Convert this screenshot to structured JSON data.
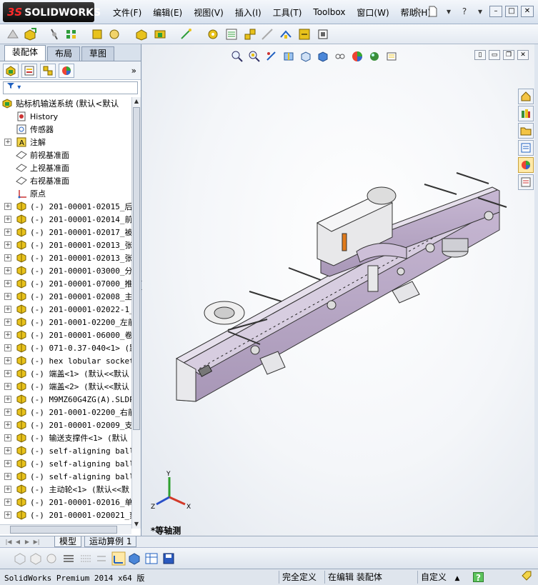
{
  "app": {
    "brand": "SOLIDWORKS",
    "brand_prefix": "3S",
    "menu": [
      "文件(F)",
      "编辑(E)",
      "视图(V)",
      "插入(I)",
      "工具(T)",
      "Toolbox",
      "窗口(W)",
      "帮助(H)"
    ]
  },
  "left_panel": {
    "tabs": [
      "装配体",
      "布局",
      "草图"
    ],
    "active_tab": "装配体",
    "more": "»",
    "tree": [
      {
        "kind": "root",
        "expand": "",
        "icon": "assembly-icon",
        "text": "贴标机输送系统  (默认<默认"
      },
      {
        "kind": "feature",
        "expand": "",
        "icon": "history-icon",
        "text": "History"
      },
      {
        "kind": "feature",
        "expand": "",
        "icon": "sensor-icon",
        "text": "传感器"
      },
      {
        "kind": "feature",
        "expand": "+",
        "icon": "annotation-icon",
        "text": "注解"
      },
      {
        "kind": "feature",
        "expand": "",
        "icon": "plane-icon",
        "text": "前视基准面"
      },
      {
        "kind": "feature",
        "expand": "",
        "icon": "plane-icon",
        "text": "上视基准面"
      },
      {
        "kind": "feature",
        "expand": "",
        "icon": "plane-icon",
        "text": "右视基准面"
      },
      {
        "kind": "feature",
        "expand": "",
        "icon": "origin-icon",
        "text": "原点"
      },
      {
        "kind": "part",
        "expand": "+",
        "icon": "subassembly-icon",
        "text": "(-) 201-00001-02015_后倾"
      },
      {
        "kind": "part",
        "expand": "+",
        "icon": "subassembly-icon",
        "text": "(-) 201-00001-02014_前倾"
      },
      {
        "kind": "part",
        "expand": "+",
        "icon": "subassembly-icon",
        "text": "(-) 201-00001-02017_被动"
      },
      {
        "kind": "part",
        "expand": "+",
        "icon": "subassembly-icon",
        "text": "(-) 201-00001-02013_张紧"
      },
      {
        "kind": "part",
        "expand": "+",
        "icon": "subassembly-icon",
        "text": "(-) 201-00001-02013_张紧"
      },
      {
        "kind": "part",
        "expand": "+",
        "icon": "subassembly-icon",
        "text": "(-) 201-00001-03000_分瓶"
      },
      {
        "kind": "part",
        "expand": "+",
        "icon": "subassembly-icon",
        "text": "(-) 201-00001-07000_推瓶"
      },
      {
        "kind": "part",
        "expand": "+",
        "icon": "subassembly-icon",
        "text": "(-) 201-00001-02008_主动"
      },
      {
        "kind": "part",
        "expand": "+",
        "icon": "subassembly-icon",
        "text": "(-) 201-00001-02022-1_调"
      },
      {
        "kind": "part",
        "expand": "+",
        "icon": "subassembly-icon",
        "text": "(-) 201-0001-02200_左前"
      },
      {
        "kind": "part",
        "expand": "+",
        "icon": "subassembly-icon",
        "text": "(-) 201-00001-06000_卷瓶"
      },
      {
        "kind": "part",
        "expand": "+",
        "icon": "subassembly-icon",
        "text": "(-) 071-0.37-040<1> (默"
      },
      {
        "kind": "part",
        "expand": "+",
        "icon": "subassembly-icon",
        "text": "(-) hex lobular socket"
      },
      {
        "kind": "part",
        "expand": "+",
        "icon": "subassembly-icon",
        "text": "(-) 端盖<1> (默认<<默认"
      },
      {
        "kind": "part",
        "expand": "+",
        "icon": "subassembly-icon",
        "text": "(-) 端盖<2> (默认<<默认"
      },
      {
        "kind": "part",
        "expand": "+",
        "icon": "subassembly-icon",
        "text": "(-) M9MZ60G4ZG(A).SLDPR"
      },
      {
        "kind": "part",
        "expand": "+",
        "icon": "subassembly-icon",
        "text": "(-) 201-0001-02200_右前"
      },
      {
        "kind": "part",
        "expand": "+",
        "icon": "subassembly-icon",
        "text": "(-) 201-00001-02009_支撑"
      },
      {
        "kind": "part",
        "expand": "+",
        "icon": "subassembly-icon",
        "text": "(-) 输送支撑件<1> (默认"
      },
      {
        "kind": "part",
        "expand": "+",
        "icon": "subassembly-icon",
        "text": "(-) self-aligning ball"
      },
      {
        "kind": "part",
        "expand": "+",
        "icon": "subassembly-icon",
        "text": "(-) self-aligning ball"
      },
      {
        "kind": "part",
        "expand": "+",
        "icon": "subassembly-icon",
        "text": "(-) self-aligning ball"
      },
      {
        "kind": "part",
        "expand": "+",
        "icon": "subassembly-icon",
        "text": "(-) 主动轮<1> (默认<<默"
      },
      {
        "kind": "part",
        "expand": "+",
        "icon": "subassembly-icon",
        "text": "(-) 201-00001-02016_单链"
      },
      {
        "kind": "part",
        "expand": "+",
        "icon": "subassembly-icon",
        "text": "(-) 201-00001-020021_刻"
      }
    ]
  },
  "graphics": {
    "view_name": "*等轴测",
    "triad_labels": {
      "x": "X",
      "y": "Y",
      "z": "Z"
    }
  },
  "bottom_tabs": [
    "模型",
    "运动算例 1"
  ],
  "active_bottom_tab": "模型",
  "status": {
    "product": "SolidWorks Premium 2014 x64 版",
    "definition": "完全定义",
    "editing": "在编辑 装配体",
    "units": "自定义",
    "units_arrow": "▲",
    "help": "?"
  },
  "colors": {
    "conveyor": "#b9a9c6",
    "part_icon_yellow": "#e8c21c",
    "accent_green": "#2e9d3a"
  }
}
